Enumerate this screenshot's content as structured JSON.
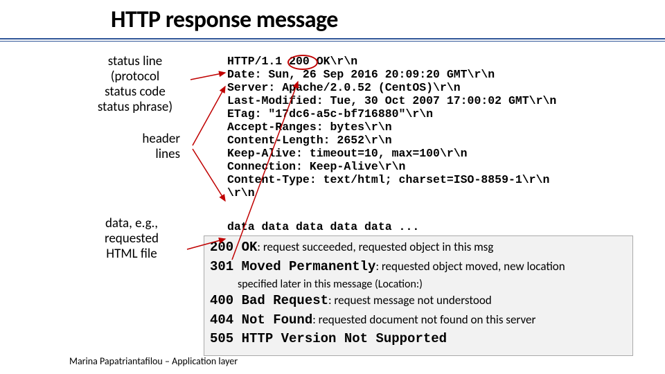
{
  "title": "HTTP response message",
  "labels": {
    "status_line": "status line\n(protocol\nstatus code\nstatus phrase)",
    "header_lines": "header\nlines",
    "data": "data, e.g.,\nrequested\nHTML file"
  },
  "http": [
    "HTTP/1.1 200 OK\\r\\n",
    "Date: Sun, 26 Sep 2016 20:09:20 GMT\\r\\n",
    "Server: Apache/2.0.52 (CentOS)\\r\\n",
    "Last-Modified: Tue, 30 Oct 2007 17:00:02 GMT\\r\\n",
    "ETag: \"17dc6-a5c-bf716880\"\\r\\n",
    "Accept-Ranges: bytes\\r\\n",
    "Content-Length: 2652\\r\\n",
    "Keep-Alive: timeout=10, max=100\\r\\n",
    "Connection: Keep-Alive\\r\\n",
    "Content-Type: text/html; charset=ISO-8859-1\\r\\n",
    "\\r\\n"
  ],
  "data_line": "data data data data data ...",
  "codes": [
    {
      "code": "200 OK",
      "desc": ": request succeeded, requested object  in this msg",
      "indent": ""
    },
    {
      "code": "301 Moved Permanently",
      "desc": ": requested object moved, new location",
      "indent": "specified later in this message (Location:)"
    },
    {
      "code": "400 Bad Request",
      "desc": ":  request message not understood",
      "indent": ""
    },
    {
      "code": "404 Not Found",
      "desc": ": requested document not found on this server",
      "indent": ""
    },
    {
      "code": "505 HTTP Version Not Supported",
      "desc": "",
      "indent": ""
    }
  ],
  "footer": "Marina Papatriantafilou –  Application layer"
}
